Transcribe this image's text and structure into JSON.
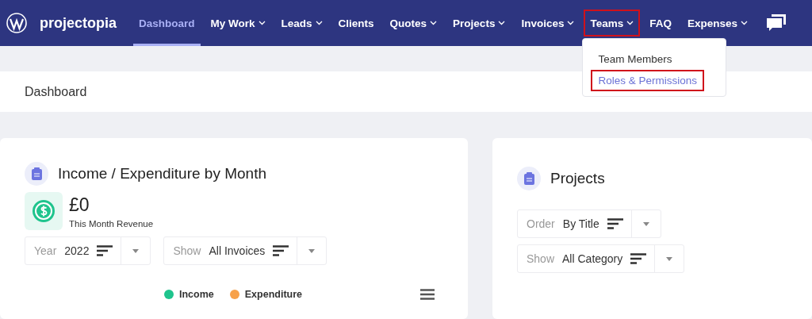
{
  "brand": "projectopia",
  "nav": [
    {
      "label": "Dashboard",
      "selected": true,
      "has_menu": false,
      "highlighted": false
    },
    {
      "label": "My Work",
      "selected": false,
      "has_menu": true,
      "highlighted": false
    },
    {
      "label": "Leads",
      "selected": false,
      "has_menu": true,
      "highlighted": false
    },
    {
      "label": "Clients",
      "selected": false,
      "has_menu": false,
      "highlighted": false
    },
    {
      "label": "Quotes",
      "selected": false,
      "has_menu": true,
      "highlighted": false
    },
    {
      "label": "Projects",
      "selected": false,
      "has_menu": true,
      "highlighted": false
    },
    {
      "label": "Invoices",
      "selected": false,
      "has_menu": true,
      "highlighted": false
    },
    {
      "label": "Teams",
      "selected": false,
      "has_menu": true,
      "highlighted": true,
      "menu": [
        {
          "label": "Team Members",
          "selected": false,
          "highlighted": false
        },
        {
          "label": "Roles & Permissions",
          "selected": true,
          "highlighted": true
        }
      ]
    },
    {
      "label": "FAQ",
      "selected": false,
      "has_menu": false,
      "highlighted": false
    },
    {
      "label": "Expenses",
      "selected": false,
      "has_menu": true,
      "highlighted": false
    }
  ],
  "breadcrumb": "Dashboard",
  "income_card": {
    "title": "Income / Expenditure by Month",
    "revenue": "£0",
    "revenue_label": "This Month Revenue",
    "filters": [
      {
        "label": "Year",
        "value": "2022"
      },
      {
        "label": "Show",
        "value": "All Invoices"
      }
    ],
    "legend": [
      {
        "label": "Income",
        "color": "#1fc48d"
      },
      {
        "label": "Expenditure",
        "color": "#f7a14a"
      }
    ]
  },
  "projects_card": {
    "title": "Projects",
    "filters": [
      {
        "label": "Order",
        "value": "By Title"
      },
      {
        "label": "Show",
        "value": "All Category"
      }
    ]
  }
}
